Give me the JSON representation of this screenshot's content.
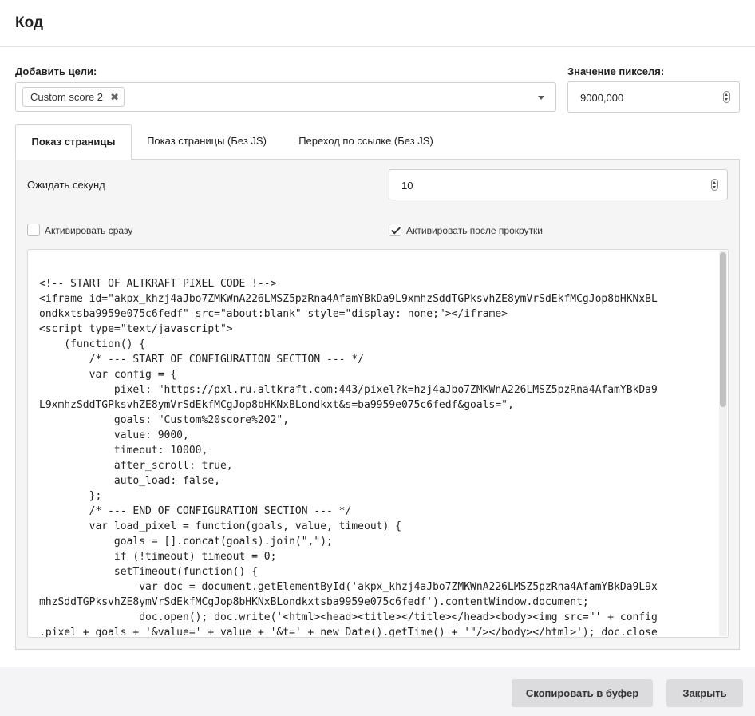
{
  "modal": {
    "title": "Код"
  },
  "goals": {
    "label": "Добавить цели:",
    "selected_tag": "Custom score 2",
    "remove_glyph": "✖"
  },
  "pixel_value": {
    "label": "Значение пикселя:",
    "value": "9000,000"
  },
  "tabs": [
    {
      "label": "Показ страницы",
      "active": true
    },
    {
      "label": "Показ страницы (Без JS)",
      "active": false
    },
    {
      "label": "Переход по ссылке (Без JS)",
      "active": false
    }
  ],
  "settings": {
    "wait_label": "Ожидать секунд",
    "wait_value": "10",
    "activate_now_label": "Активировать сразу",
    "activate_now_checked": false,
    "activate_scroll_label": "Активировать после прокрутки",
    "activate_scroll_checked": true
  },
  "code": {
    "lines": [
      "<!-- START OF ALTKRAFT PIXEL CODE !-->",
      "<iframe id=\"akpx_khzj4aJbo7ZMKWnA226LMSZ5pzRna4AfamYBkDa9L9xmhzSddTGPksvhZE8ymVrSdEkfMCgJop8bHKNxBL",
      "ondkxtsba9959e075c6fedf\" src=\"about:blank\" style=\"display: none;\"></iframe>",
      "<script type=\"text/javascript\">",
      "    (function() {",
      "        /* --- START OF CONFIGURATION SECTION --- */",
      "        var config = {",
      "            pixel: \"https://pxl.ru.altkraft.com:443/pixel?k=hzj4aJbo7ZMKWnA226LMSZ5pzRna4AfamYBkDa9",
      "L9xmhzSddTGPksvhZE8ymVrSdEkfMCgJop8bHKNxBLondkxt&s=ba9959e075c6fedf&goals=\",",
      "            goals: \"Custom%20score%202\",",
      "            value: 9000,",
      "            timeout: 10000,",
      "            after_scroll: true,",
      "            auto_load: false,",
      "        };",
      "        /* --- END OF CONFIGURATION SECTION --- */",
      "        var load_pixel = function(goals, value, timeout) {",
      "            goals = [].concat(goals).join(\",\");",
      "            if (!timeout) timeout = 0;",
      "            setTimeout(function() {",
      "                var doc = document.getElementById('akpx_khzj4aJbo7ZMKWnA226LMSZ5pzRna4AfamYBkDa9L9x",
      "mhzSddTGPksvhZE8ymVrSdEkfMCgJop8bHKNxBLondkxtsba9959e075c6fedf').contentWindow.document;",
      "                doc.open(); doc.write('<html><head><title></title></head><body><img src=\"' + config",
      ".pixel + goals + '&value=' + value + '&t=' + new Date().getTime() + '\"/></body></html>'); doc.close"
    ]
  },
  "footer": {
    "copy_label": "Скопировать в буфер",
    "close_label": "Закрыть"
  }
}
